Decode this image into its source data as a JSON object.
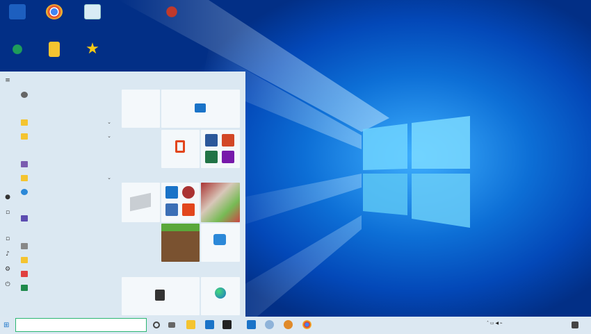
{
  "desktop": {
    "icons": [
      {
        "label": "",
        "color": "#1d5fbf"
      },
      {
        "label": "",
        "color": "#e0342c"
      },
      {
        "label": "",
        "color": "#d9ecf5"
      },
      {
        "label": "",
        "color": "#c0392b"
      },
      {
        "label": "",
        "color": "#1e9c5a"
      },
      {
        "label": "",
        "color": "#f4c430"
      },
      {
        "label": "",
        "color": "#f6c915"
      }
    ]
  },
  "start_menu": {
    "apps": [
      {
        "letter": "",
        "label": "",
        "icon": "user-icon",
        "color": "#666"
      },
      {
        "letter": "",
        "label": "",
        "icon": "folder-icon",
        "color": "#f4c430",
        "expand": true
      },
      {
        "letter": "",
        "label": "",
        "icon": "folder-icon",
        "color": "#f4c430",
        "expand": true
      },
      {
        "letter": "",
        "label": "",
        "icon": "app-icon",
        "color": "#7a5cb0"
      },
      {
        "letter": "",
        "label": "",
        "icon": "folder-icon",
        "color": "#f4c430",
        "expand": true
      },
      {
        "letter": "",
        "label": "",
        "icon": "app-icon",
        "color": "#2b88d8"
      },
      {
        "letter": "",
        "label": "",
        "icon": "app-icon",
        "color": "#5c4db1"
      },
      {
        "letter": "",
        "label": "",
        "icon": "app-icon",
        "color": "#888"
      },
      {
        "letter": "",
        "label": "",
        "icon": "folder-icon",
        "color": "#f4c430"
      },
      {
        "letter": "",
        "label": "",
        "icon": "app-icon",
        "color": "#e04040"
      },
      {
        "letter": "",
        "label": "",
        "icon": "app-icon",
        "color": "#1f8a4c"
      }
    ],
    "tile_groups": [
      {
        "label": ""
      },
      {
        "label": ""
      },
      {
        "label": ""
      }
    ],
    "tiles": {
      "calendar_day": "",
      "calendar_num": "",
      "mail": "",
      "office": ""
    }
  },
  "taskbar": {
    "search_placeholder": "",
    "clock": ""
  }
}
